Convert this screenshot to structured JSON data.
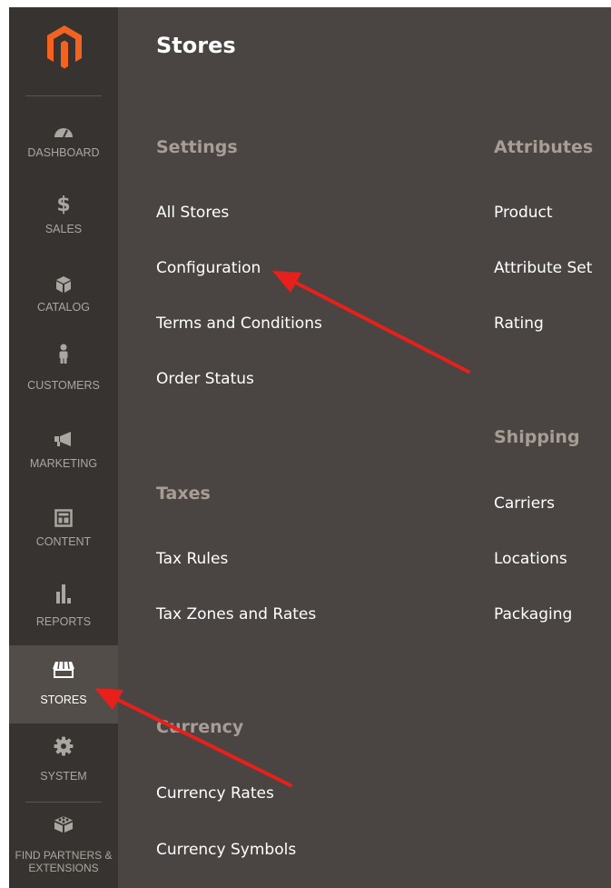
{
  "sidebar": {
    "items": [
      {
        "label": "DASHBOARD",
        "icon": "dashboard-icon"
      },
      {
        "label": "SALES",
        "icon": "dollar-icon"
      },
      {
        "label": "CATALOG",
        "icon": "cube-icon"
      },
      {
        "label": "CUSTOMERS",
        "icon": "person-icon"
      },
      {
        "label": "MARKETING",
        "icon": "megaphone-icon"
      },
      {
        "label": "CONTENT",
        "icon": "layout-icon"
      },
      {
        "label": "REPORTS",
        "icon": "bar-chart-icon"
      },
      {
        "label": "STORES",
        "icon": "storefront-icon"
      },
      {
        "label": "SYSTEM",
        "icon": "gear-icon"
      },
      {
        "label": "FIND PARTNERS & EXTENSIONS",
        "icon": "blocks-icon"
      }
    ],
    "active": "STORES"
  },
  "panel": {
    "title": "Stores",
    "settings": {
      "heading": "Settings",
      "items": [
        "All Stores",
        "Configuration",
        "Terms and Conditions",
        "Order Status"
      ]
    },
    "taxes": {
      "heading": "Taxes",
      "items": [
        "Tax Rules",
        "Tax Zones and Rates"
      ]
    },
    "currency": {
      "heading": "Currency",
      "items": [
        "Currency Rates",
        "Currency Symbols"
      ]
    },
    "attributes": {
      "heading": "Attributes",
      "items": [
        "Product",
        "Attribute Set",
        "Rating"
      ]
    },
    "shipping": {
      "heading": "Shipping",
      "items": [
        "Carriers",
        "Locations",
        "Packaging"
      ]
    }
  },
  "colors": {
    "sidebar_bg": "#373330",
    "panel_bg": "#4a4542",
    "active_bg": "#524d49",
    "logo_orange": "#f26322",
    "arrow_red": "#e8201c"
  }
}
